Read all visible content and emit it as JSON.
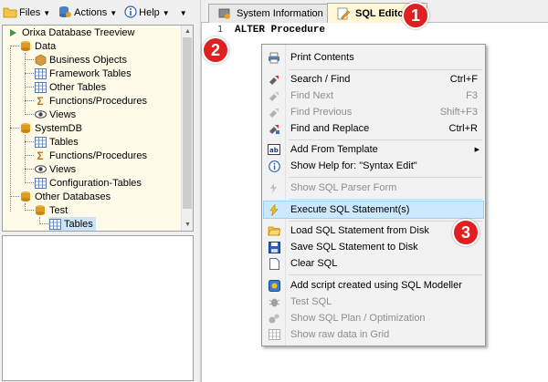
{
  "toolbar": {
    "files_label": "Files",
    "actions_label": "Actions",
    "help_label": "Help"
  },
  "tree": {
    "items": [
      {
        "label": "Orixa Database Treeview",
        "icon": "play-arrow-icon"
      },
      {
        "label": "Data",
        "icon": "database-icon"
      },
      {
        "label": "Business Objects",
        "icon": "box-icon"
      },
      {
        "label": "Framework Tables",
        "icon": "grid-icon"
      },
      {
        "label": "Other Tables",
        "icon": "grid-icon"
      },
      {
        "label": "Functions/Procedures",
        "icon": "sigma-icon"
      },
      {
        "label": "Views",
        "icon": "eye-icon"
      },
      {
        "label": "SystemDB",
        "icon": "database-icon"
      },
      {
        "label": "Tables",
        "icon": "grid-icon"
      },
      {
        "label": "Functions/Procedures",
        "icon": "sigma-icon"
      },
      {
        "label": "Views",
        "icon": "eye-icon"
      },
      {
        "label": "Configuration-Tables",
        "icon": "grid-icon"
      },
      {
        "label": "Other Databases",
        "icon": "database-icon"
      },
      {
        "label": "Test",
        "icon": "database-icon"
      },
      {
        "label": "Tables",
        "icon": "grid-icon"
      }
    ]
  },
  "tabs": {
    "system_info": "System Information",
    "sql_editor": "SQL Editor"
  },
  "editor": {
    "line_number": "1",
    "code": "ALTER Procedure"
  },
  "context_menu": {
    "print_contents": "Print Contents",
    "search_find": "Search / Find",
    "search_find_shortcut": "Ctrl+F",
    "find_next": "Find Next",
    "find_next_shortcut": "F3",
    "find_previous": "Find Previous",
    "find_previous_shortcut": "Shift+F3",
    "find_replace": "Find and Replace",
    "find_replace_shortcut": "Ctrl+R",
    "add_from_template": "Add From Template",
    "show_help": "Show Help for: \"Syntax Edit\"",
    "show_sql_parser": "Show SQL Parser Form",
    "execute_sql": "Execute SQL Statement(s)",
    "load_sql": "Load SQL Statement from Disk",
    "save_sql": "Save SQL Statement to Disk",
    "clear_sql": "Clear SQL",
    "add_script": "Add script created using SQL Modeller",
    "test_sql": "Test SQL",
    "show_sql_plan": "Show SQL Plan / Optimization",
    "show_raw_data": "Show raw data in Grid"
  },
  "callouts": {
    "one": "1",
    "two": "2",
    "three": "3"
  },
  "colors": {
    "callout_red": "#e02020",
    "selection_blue": "#cce8ff",
    "tree_background": "#fffbe8",
    "active_tab": "#fff7d6"
  }
}
